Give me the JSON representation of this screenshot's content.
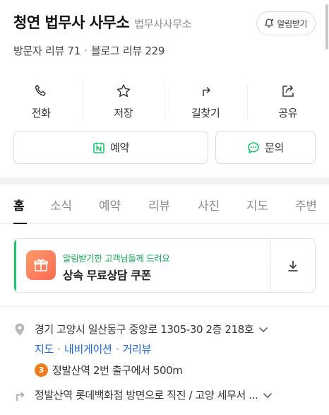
{
  "place": {
    "name": "청연 법무사 사무소",
    "category": "법무사사무소",
    "notify_label": "알림받기",
    "visitor_reviews": "방문자 리뷰 71",
    "blog_reviews": "블로그 리뷰 229"
  },
  "actions": [
    {
      "label": "전화",
      "icon": "phone-icon"
    },
    {
      "label": "저장",
      "icon": "star-icon"
    },
    {
      "label": "길찾기",
      "icon": "directions-icon"
    },
    {
      "label": "공유",
      "icon": "share-icon"
    }
  ],
  "buttons": {
    "reserve": "예약",
    "inquiry": "문의"
  },
  "tabs": [
    "홈",
    "소식",
    "예약",
    "리뷰",
    "사진",
    "지도",
    "주변"
  ],
  "active_tab": "홈",
  "coupon": {
    "subtitle": "알림받기한 고객님들께 드려요",
    "title": "상속 무료상담 쿠폰"
  },
  "address": {
    "text": "경기 고양시 일산동구 중앙로 1305-30 2층 218호",
    "links": [
      "지도",
      "내비게이션",
      "거리뷰"
    ],
    "station_badge": "3",
    "station_text": "정발산역 2번 출구에서 500m"
  },
  "directions": {
    "text": "정발산역 롯데백화점 방면으로 직진 / 고양 세무서 ..."
  },
  "colors": {
    "link": "#1f63d8",
    "naver_green": "#1fc56e",
    "line3_orange": "#ef7c1a",
    "coupon_gift": "#ff7a5c"
  }
}
